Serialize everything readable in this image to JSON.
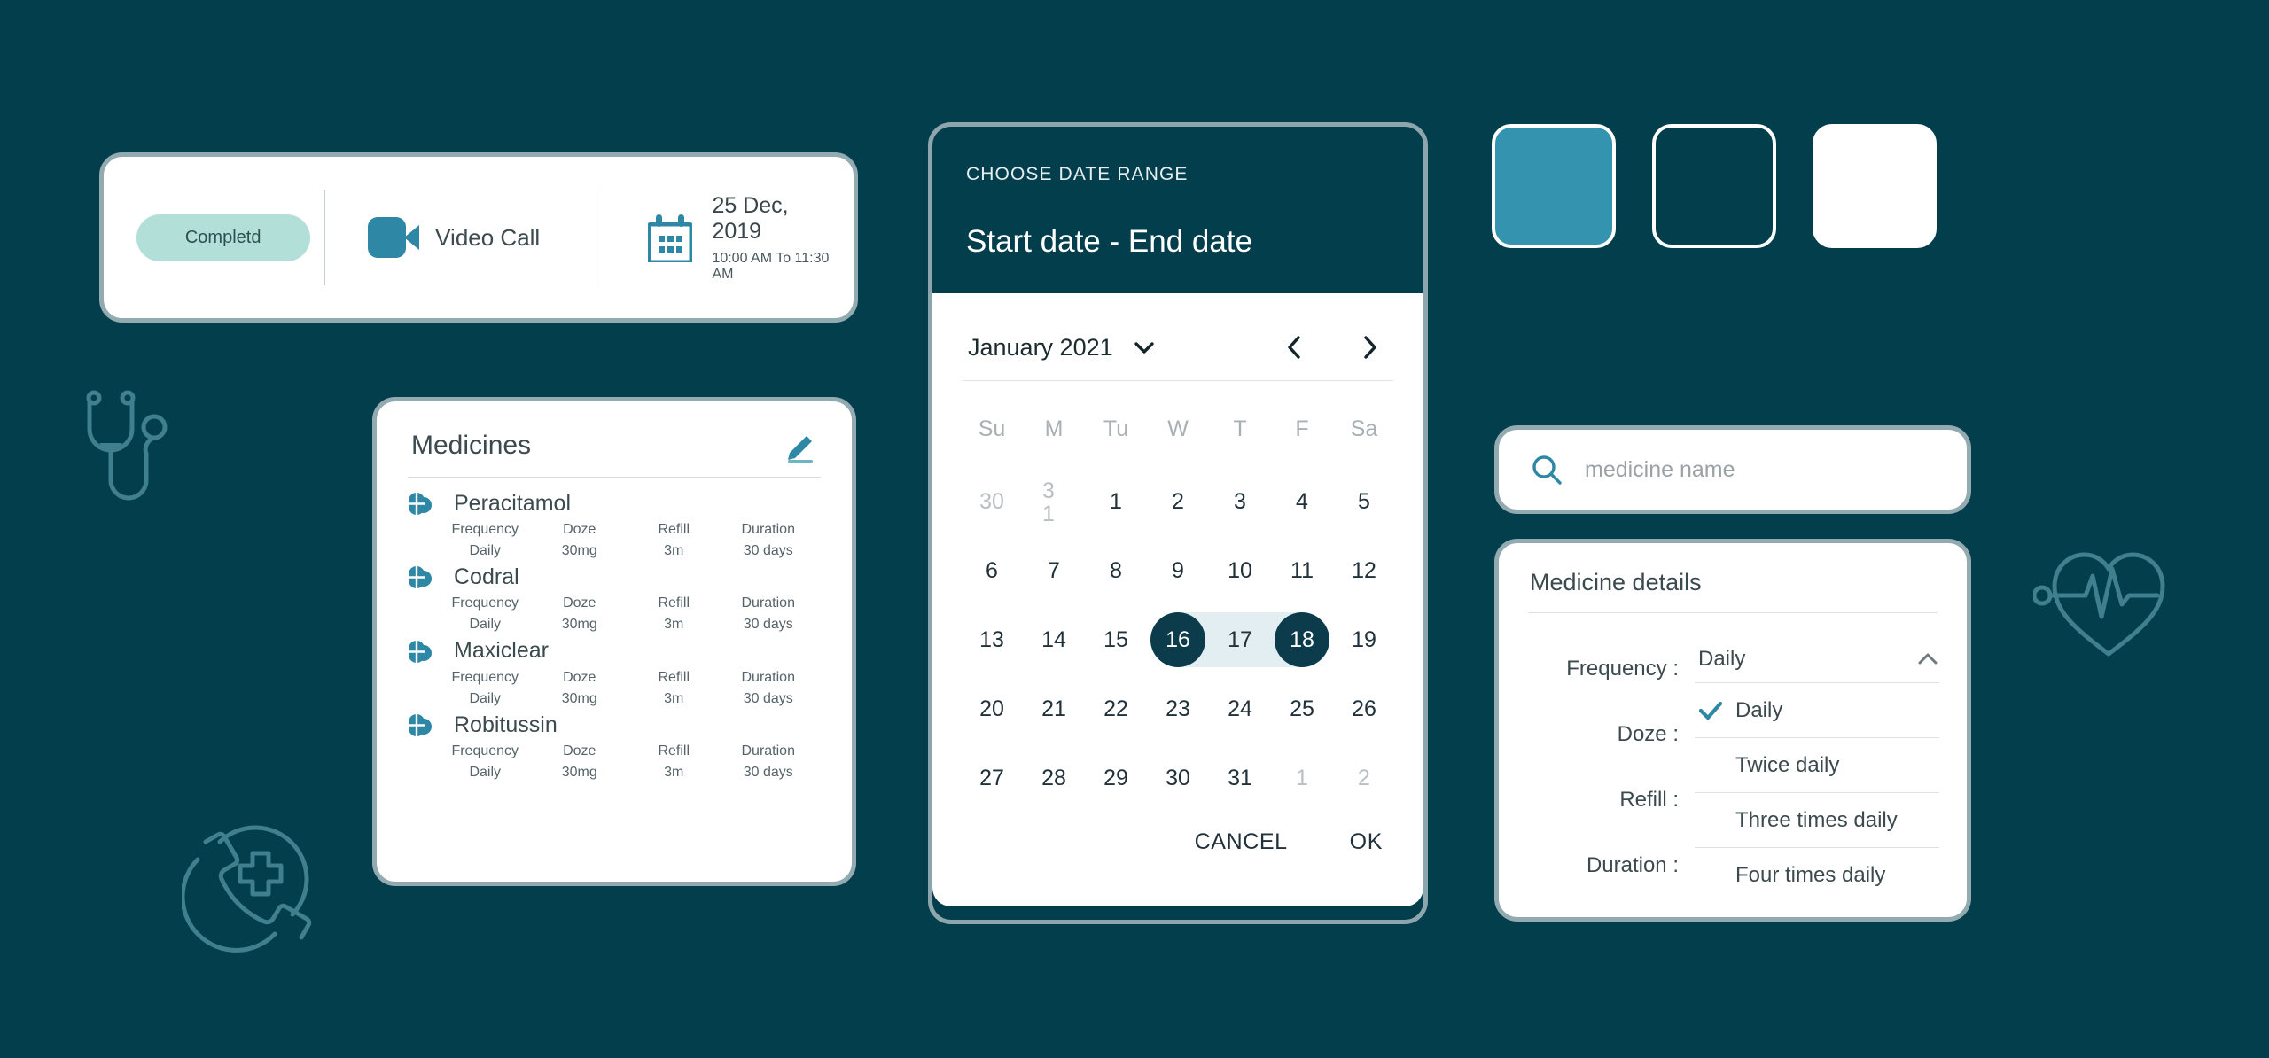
{
  "theme": {
    "background": "#033e4c",
    "accent_teal": "#3493ae",
    "dark_teal": "#0c3c4b",
    "card_border": "#92aab0",
    "status_pill_bg": "#b2e0d8",
    "range_band": "#e2eef1"
  },
  "appointment": {
    "status_label": "Completd",
    "call_type_label": "Video Call",
    "date": "25 Dec, 2019",
    "time_range": "10:00 AM To 11:30 AM",
    "video_icon": "video-camera-icon",
    "calendar_icon": "calendar-icon"
  },
  "medicines": {
    "title": "Medicines",
    "edit_icon": "pencil-edit-icon",
    "columns": [
      "Frequency",
      "Doze",
      "Refill",
      "Duration"
    ],
    "items": [
      {
        "name": "Peracitamol",
        "frequency": "Daily",
        "doze": "30mg",
        "refill": "3m",
        "duration": "30 days"
      },
      {
        "name": "Codral",
        "frequency": "Daily",
        "doze": "30mg",
        "refill": "3m",
        "duration": "30 days"
      },
      {
        "name": "Maxiclear",
        "frequency": "Daily",
        "doze": "30mg",
        "refill": "3m",
        "duration": "30 days"
      },
      {
        "name": "Robitussin",
        "frequency": "Daily",
        "doze": "30mg",
        "refill": "3m",
        "duration": "30 days"
      }
    ]
  },
  "date_range_dialog": {
    "kicker": "CHOOSE DATE RANGE",
    "range_placeholder": "Start date - End date",
    "month_label": "January 2021",
    "dropdown_icon": "chevron-down-icon",
    "prev_icon": "chevron-left-icon",
    "next_icon": "chevron-right-icon",
    "weekdays": [
      "Su",
      "M",
      "Tu",
      "W",
      "T",
      "F",
      "Sa"
    ],
    "weeks": [
      [
        {
          "d": "30",
          "muted": true
        },
        {
          "d": "31",
          "muted": true,
          "wrap": true
        },
        {
          "d": "1"
        },
        {
          "d": "2"
        },
        {
          "d": "3"
        },
        {
          "d": "4"
        },
        {
          "d": "5"
        }
      ],
      [
        {
          "d": "6"
        },
        {
          "d": "7"
        },
        {
          "d": "8"
        },
        {
          "d": "9"
        },
        {
          "d": "10"
        },
        {
          "d": "11"
        },
        {
          "d": "12"
        }
      ],
      [
        {
          "d": "13"
        },
        {
          "d": "14"
        },
        {
          "d": "15"
        },
        {
          "d": "16",
          "selected": true,
          "range_start": true
        },
        {
          "d": "17",
          "inrange": true
        },
        {
          "d": "18",
          "selected": true,
          "range_end": true
        },
        {
          "d": "19"
        }
      ],
      [
        {
          "d": "20"
        },
        {
          "d": "21"
        },
        {
          "d": "22"
        },
        {
          "d": "23"
        },
        {
          "d": "24"
        },
        {
          "d": "25"
        },
        {
          "d": "26"
        }
      ],
      [
        {
          "d": "27"
        },
        {
          "d": "28"
        },
        {
          "d": "29"
        },
        {
          "d": "30"
        },
        {
          "d": "31"
        },
        {
          "d": "1",
          "muted": true
        },
        {
          "d": "2",
          "muted": true
        }
      ]
    ],
    "cancel_label": "CANCEL",
    "ok_label": "OK"
  },
  "swatches": [
    {
      "name": "accent-teal",
      "color": "#3493ae"
    },
    {
      "name": "dark-teal",
      "color": "#033e4c"
    },
    {
      "name": "white",
      "color": "#ffffff"
    }
  ],
  "search": {
    "placeholder": "medicine name",
    "value": "",
    "icon": "search-icon"
  },
  "medicine_details": {
    "title": "Medicine details",
    "labels": [
      "Frequency :",
      "Doze :",
      "Refill :",
      "Duration :"
    ],
    "frequency_selected": "Daily",
    "collapse_icon": "chevron-up-icon",
    "check_icon": "check-icon",
    "options": [
      "Daily",
      "Twice daily",
      "Three times daily",
      "Four times daily"
    ]
  },
  "decorations": [
    {
      "name": "stethoscope-icon"
    },
    {
      "name": "emergency-call-icon"
    },
    {
      "name": "heartbeat-icon"
    }
  ]
}
